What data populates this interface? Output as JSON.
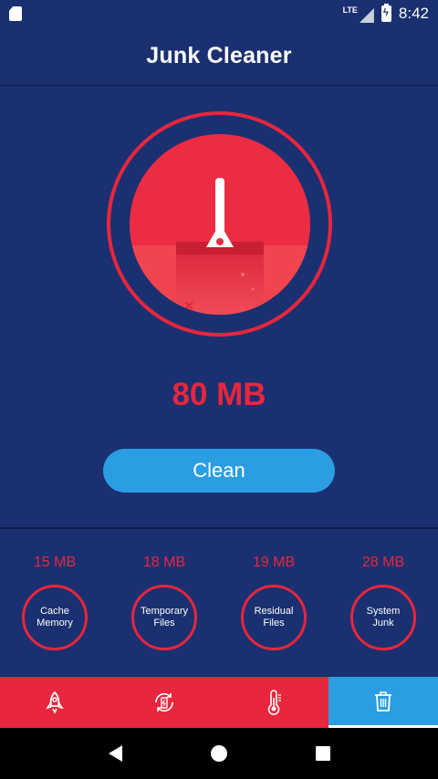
{
  "status_bar": {
    "network": "LTE",
    "time": "8:42",
    "icons": [
      "sd-card-icon",
      "signal-icon",
      "battery-charging-icon"
    ]
  },
  "header": {
    "title": "Junk Cleaner"
  },
  "main": {
    "total_junk": "80 MB",
    "clean_label": "Clean",
    "broom_icon": "broom-icon"
  },
  "categories": [
    {
      "size": "15 MB",
      "label": "Cache Memory"
    },
    {
      "size": "18 MB",
      "label": "Temporary Files"
    },
    {
      "size": "19 MB",
      "label": "Residual Files"
    },
    {
      "size": "28 MB",
      "label": "System Junk"
    }
  ],
  "bottom_nav": {
    "items": [
      {
        "icon": "rocket-icon",
        "active": false
      },
      {
        "icon": "battery-refresh-icon",
        "active": false
      },
      {
        "icon": "thermometer-icon",
        "active": false
      },
      {
        "icon": "trash-icon",
        "active": true
      }
    ]
  },
  "colors": {
    "background": "#1a3070",
    "accent_red": "#e8263d",
    "accent_blue": "#2a9de3"
  }
}
